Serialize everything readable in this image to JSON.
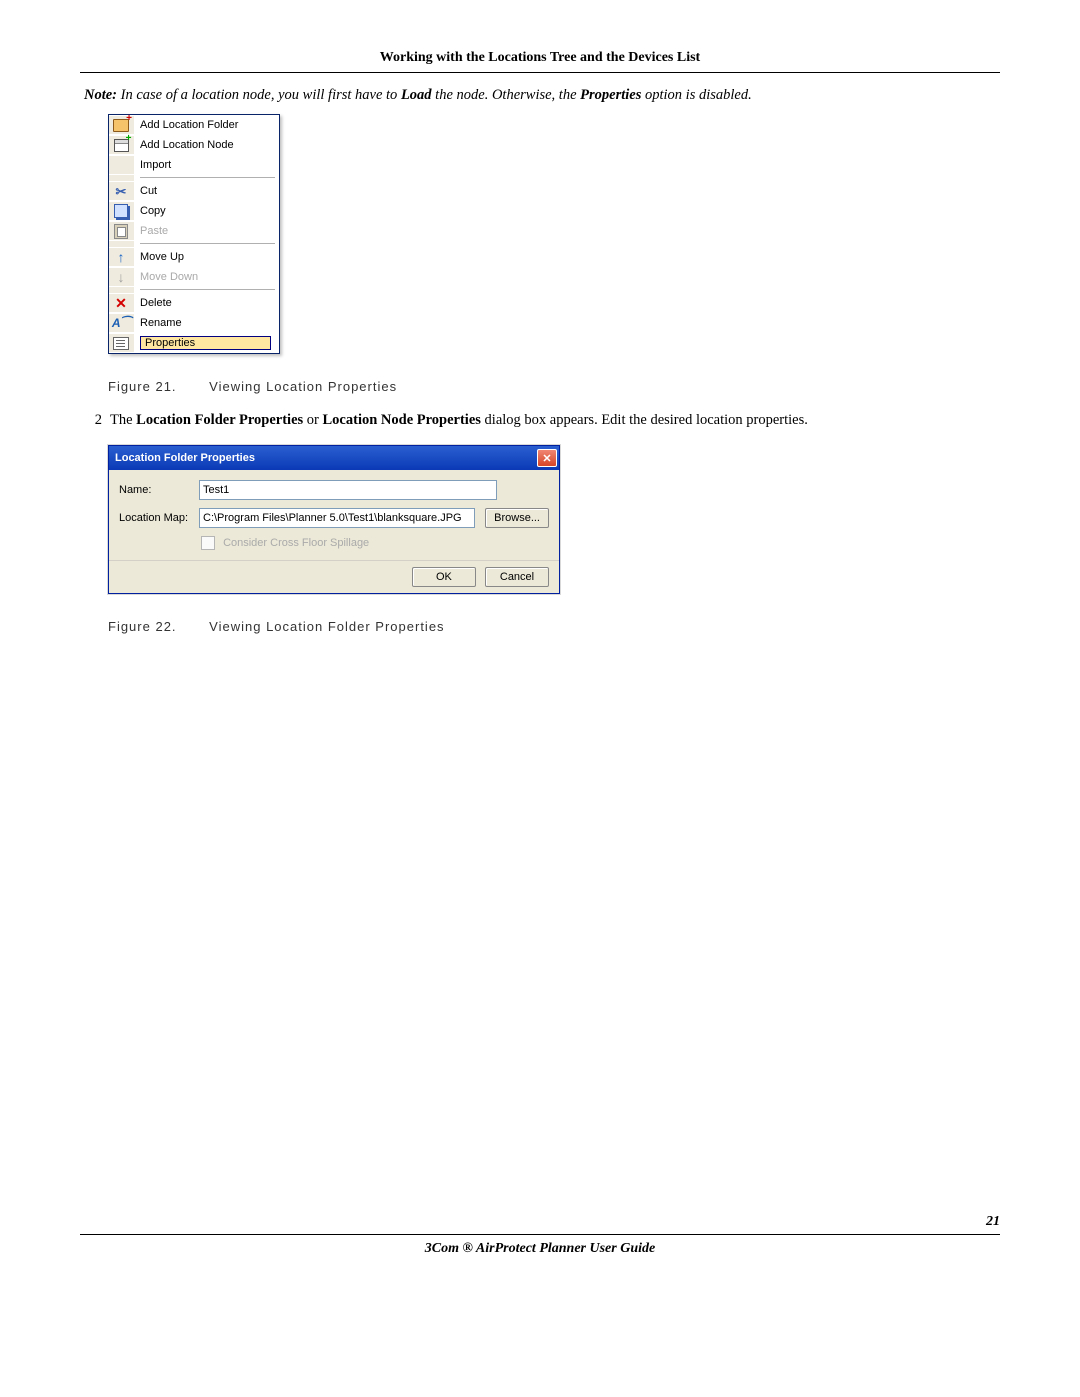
{
  "header": {
    "title": "Working with the Locations Tree and the Devices List"
  },
  "note": {
    "prefix": "Note:",
    "part1": " In case of a location node, you will first have to ",
    "load": "Load",
    "part2": " the node. Otherwise, the ",
    "properties": "Properties",
    "part3": " option is disabled."
  },
  "context_menu": {
    "items": [
      {
        "label": "Add Location Folder",
        "icon": "ic-folder-add",
        "disabled": false
      },
      {
        "label": "Add Location Node",
        "icon": "ic-node-add",
        "disabled": false
      },
      {
        "label": "Import",
        "icon": "",
        "disabled": false
      }
    ],
    "group2": [
      {
        "label": "Cut",
        "icon": "ic-cut",
        "glyph": "✂",
        "disabled": false
      },
      {
        "label": "Copy",
        "icon": "ic-copy",
        "disabled": false
      },
      {
        "label": "Paste",
        "icon": "ic-paste",
        "disabled": true
      }
    ],
    "group3": [
      {
        "label": "Move Up",
        "icon": "ic-up",
        "glyph": "↑",
        "disabled": false
      },
      {
        "label": "Move Down",
        "icon": "ic-down",
        "glyph": "↓",
        "disabled": true
      }
    ],
    "group4": [
      {
        "label": "Delete",
        "icon": "ic-del",
        "glyph": "✕",
        "disabled": false
      },
      {
        "label": "Rename",
        "icon": "ic-rename",
        "glyph": "A",
        "disabled": false
      }
    ],
    "selected": {
      "label": "Properties",
      "icon": "ic-prop"
    }
  },
  "figure21": {
    "num": "Figure 21.",
    "caption": "Viewing Location Properties"
  },
  "step2": {
    "num": "2",
    "pre": "The ",
    "b1": "Location Folder Properties",
    "mid1": " or ",
    "b2": "Location Node Properties",
    "post": " dialog box appears. Edit the desired location properties."
  },
  "dialog": {
    "title": "Location Folder Properties",
    "name_label": "Name:",
    "name_value": "Test1",
    "map_label": "Location Map:",
    "map_value": "C:\\Program Files\\Planner 5.0\\Test1\\blanksquare.JPG",
    "browse": "Browse...",
    "checkbox": "Consider Cross Floor Spillage",
    "ok": "OK",
    "cancel": "Cancel"
  },
  "figure22": {
    "num": "Figure 22.",
    "caption": "Viewing Location Folder Properties"
  },
  "page_number": "21",
  "footer": "3Com ® AirProtect Planner User Guide"
}
